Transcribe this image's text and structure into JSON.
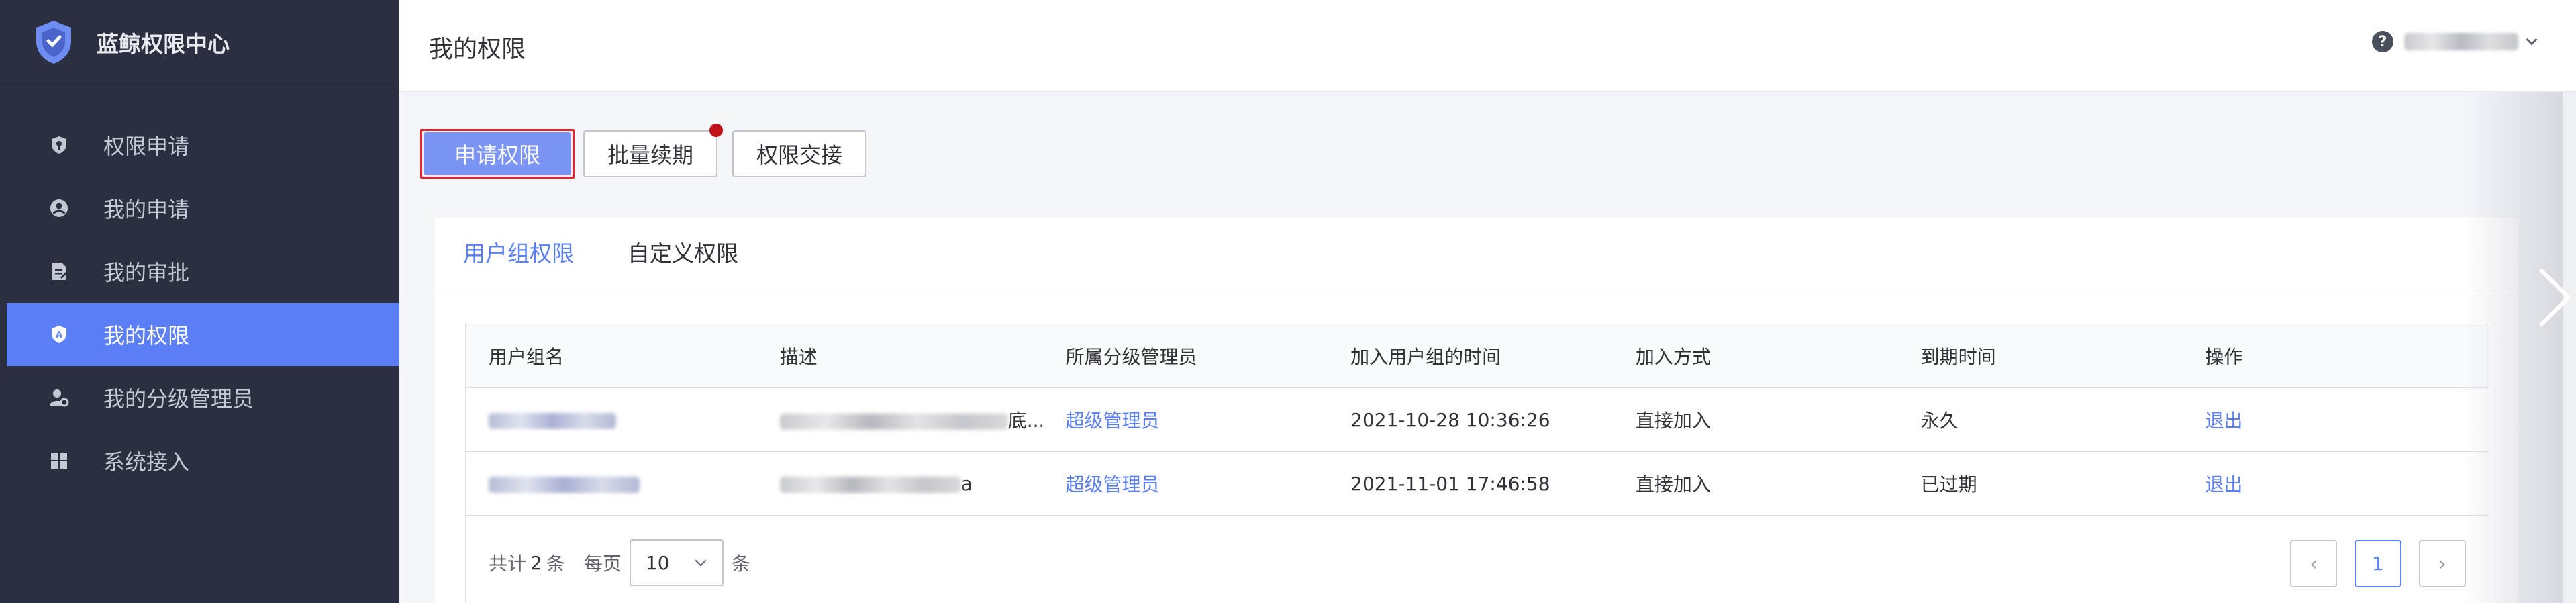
{
  "brand": {
    "title": "蓝鲸权限中心"
  },
  "sidebar": {
    "items": [
      {
        "label": "权限申请",
        "icon": "shield-key-icon"
      },
      {
        "label": "我的申请",
        "icon": "user-circle-icon"
      },
      {
        "label": "我的审批",
        "icon": "document-edit-icon"
      },
      {
        "label": "我的权限",
        "icon": "shield-a-icon"
      },
      {
        "label": "我的分级管理员",
        "icon": "user-gear-icon"
      },
      {
        "label": "系统接入",
        "icon": "grid-icon"
      }
    ]
  },
  "header": {
    "title": "我的权限",
    "help": "?"
  },
  "toolbar": {
    "apply_label": "申请权限",
    "renew_label": "批量续期",
    "handover_label": "权限交接"
  },
  "tabs": [
    {
      "label": "用户组权限"
    },
    {
      "label": "自定义权限"
    }
  ],
  "table": {
    "columns": [
      "用户组名",
      "描述",
      "所属分级管理员",
      "加入用户组的时间",
      "加入方式",
      "到期时间",
      "操作"
    ],
    "rows": [
      {
        "desc_tail": "底...",
        "admin": "超级管理员",
        "join_time": "2021-10-28 10:36:26",
        "join_method": "直接加入",
        "expire": "永久",
        "action": "退出"
      },
      {
        "desc_tail": "a",
        "admin": "超级管理员",
        "join_time": "2021-11-01 17:46:58",
        "join_method": "直接加入",
        "expire": "已过期",
        "action": "退出"
      }
    ]
  },
  "pagination": {
    "total_prefix": "共计",
    "total": "2",
    "total_suffix": "条",
    "per_page_label": "每页",
    "per_page": "10",
    "per_page_suffix": "条",
    "current_page": "1"
  }
}
